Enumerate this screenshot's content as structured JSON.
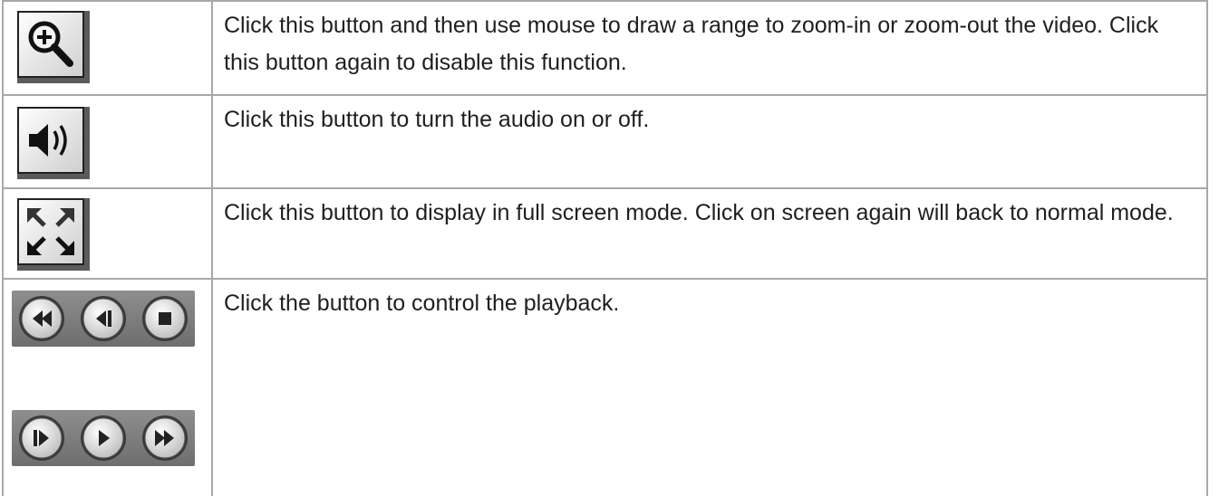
{
  "rows": [
    {
      "icon": "zoom-in-icon",
      "description": "Click this button and then use mouse to draw a range to zoom-in or zoom-out the video. Click this button again to disable this function."
    },
    {
      "icon": "speaker-icon",
      "description": "Click this button to turn the audio on or off."
    },
    {
      "icon": "fullscreen-icon",
      "description": "Click this button to display in full screen mode. Click on screen again will back to normal mode."
    },
    {
      "icons": [
        "rewind-icon",
        "step-back-icon",
        "stop-icon",
        "step-forward-icon",
        "play-icon",
        "fast-forward-icon"
      ],
      "description": "Click the button to control the playback."
    }
  ],
  "colors": {
    "border": "#a8a8a8",
    "text": "#1f1f1f",
    "button_face": "#e6e6e6",
    "button_shadow": "#5b5b5b"
  }
}
